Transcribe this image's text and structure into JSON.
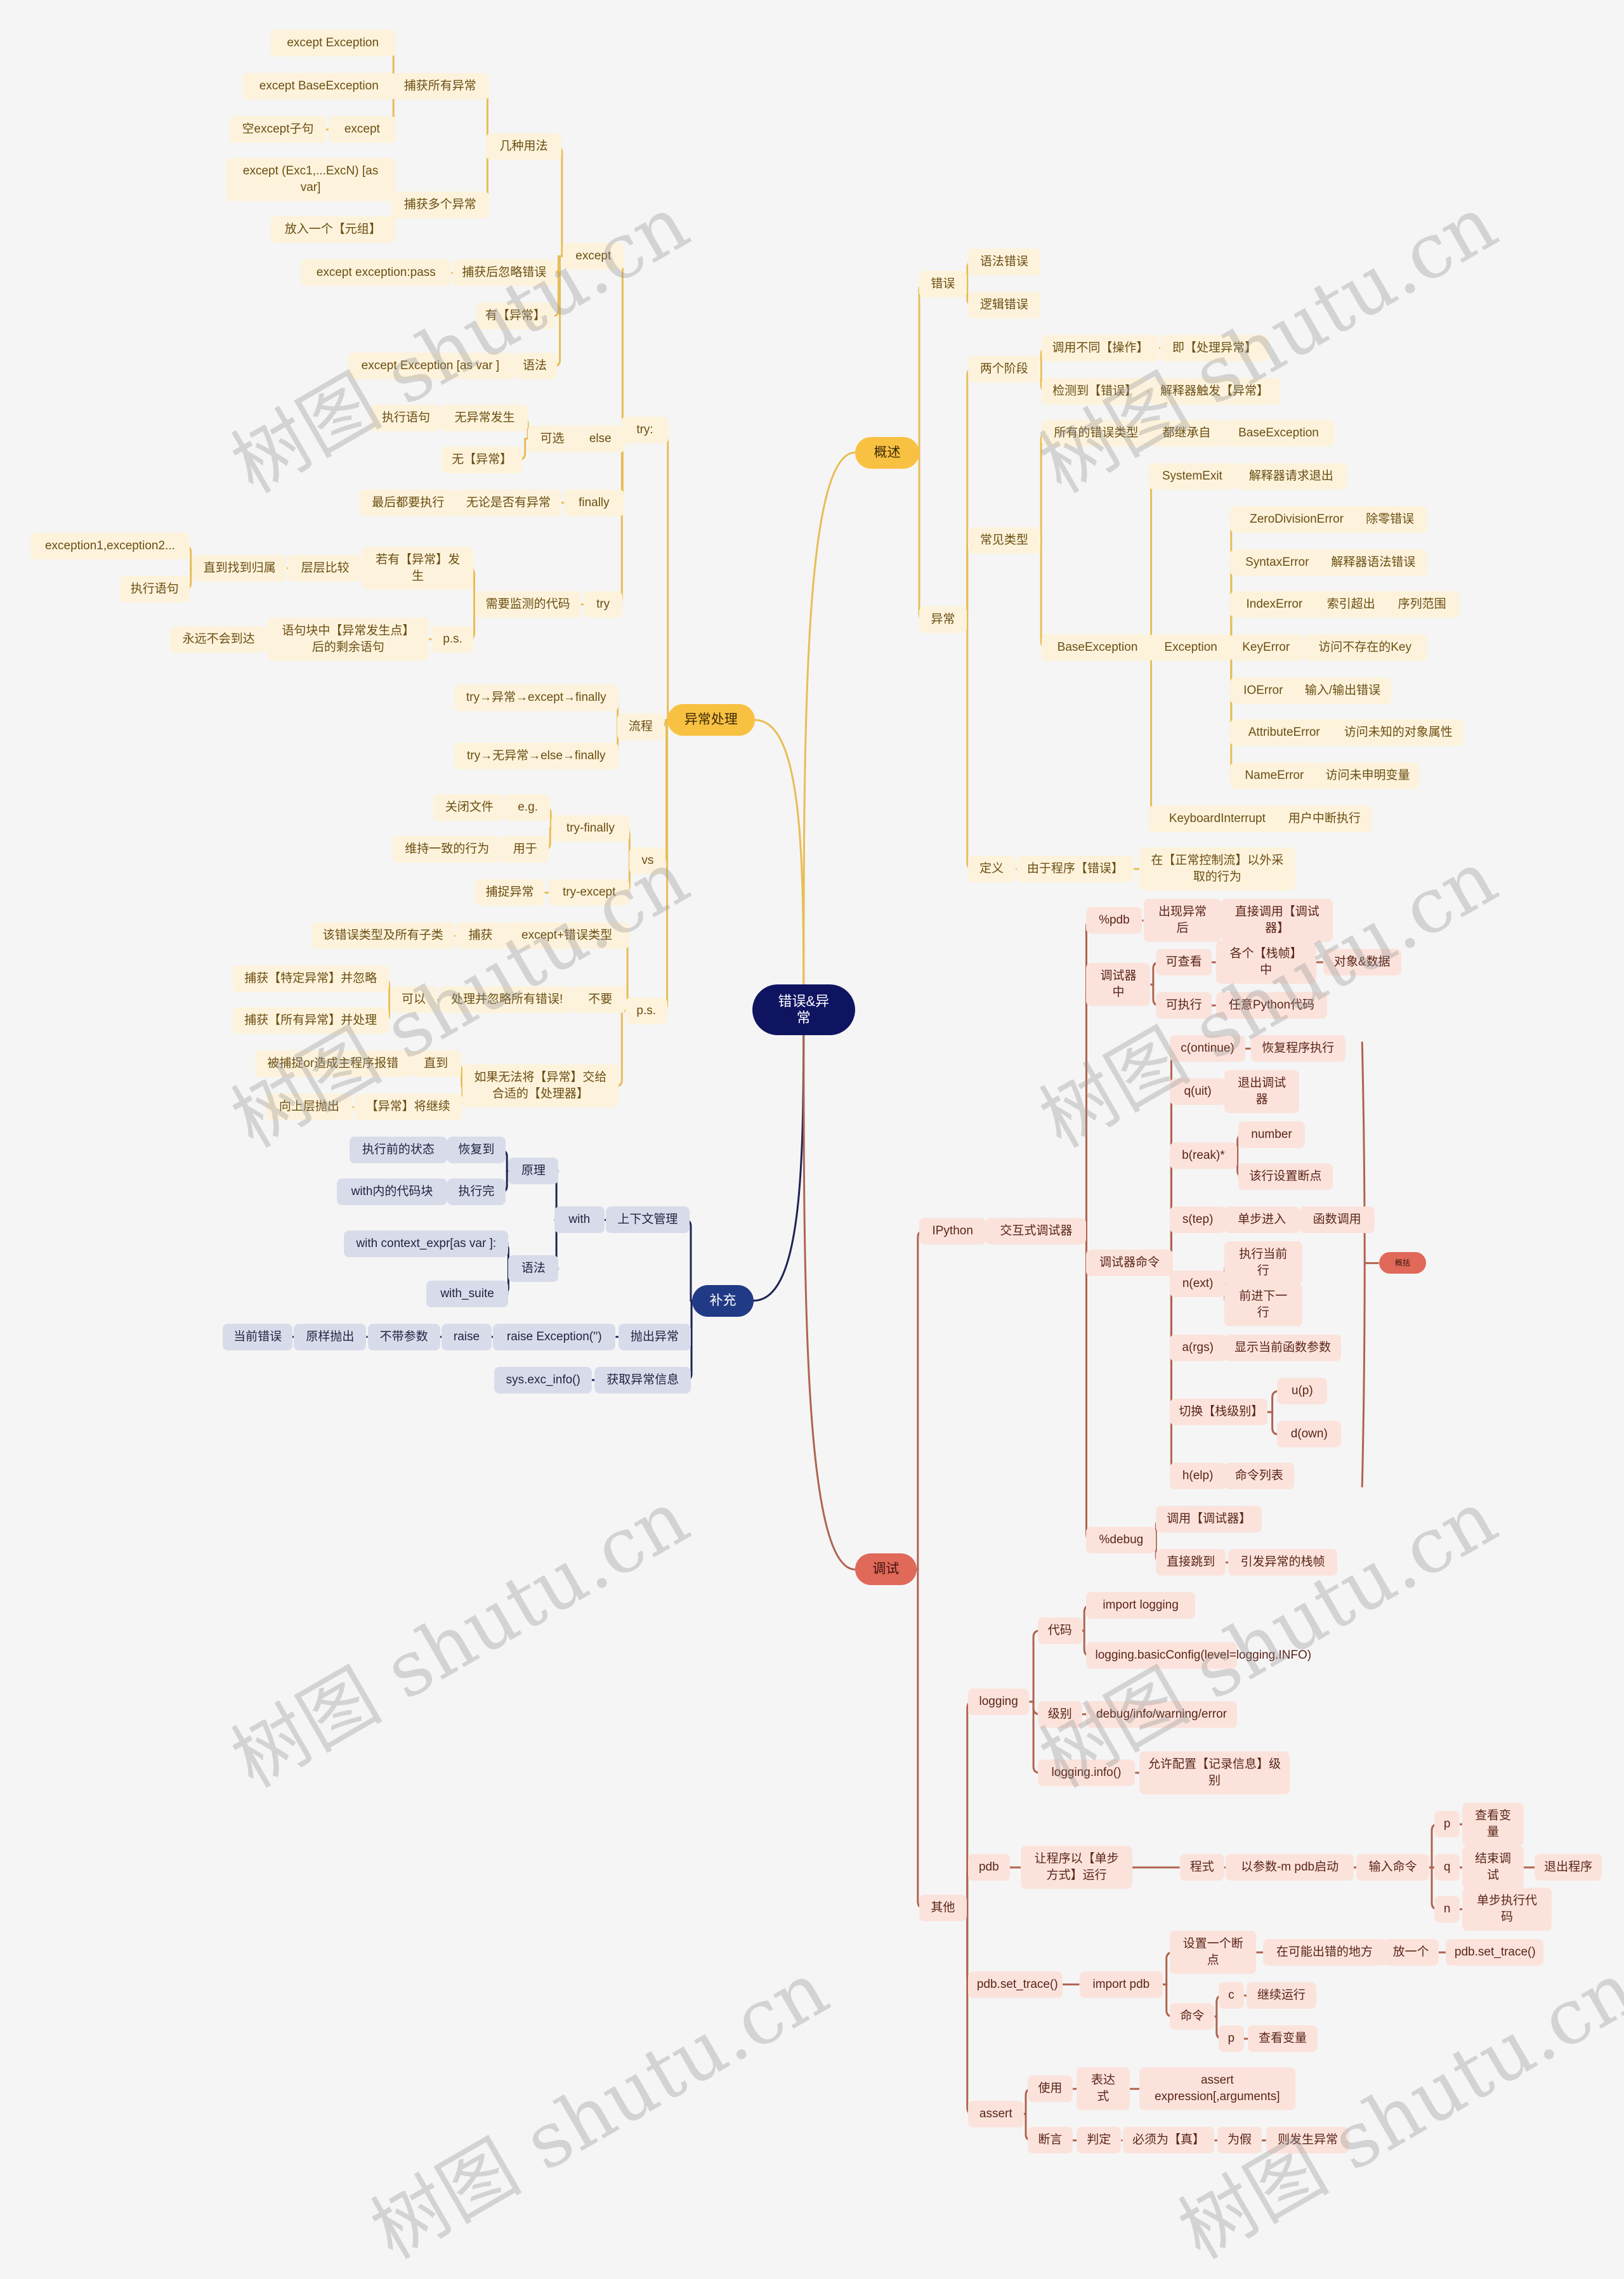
{
  "title": "错误&异常",
  "colors": {
    "yellow": "#f9c142",
    "red": "#e0695a",
    "blue": "#213a85",
    "root": "#0f1461",
    "background": "#f5f5f5"
  },
  "watermark": "树图 shutu.cn",
  "summary_label": "概括",
  "branches": {
    "exception_handling": {
      "label": "异常处理",
      "try": {
        "label": "try:",
        "except": {
          "label": "except",
          "usages": {
            "label": "几种用法",
            "catch_all": {
              "label": "捕获所有异常",
              "items": [
                "except Exception",
                "except BaseException",
                "except"
              ],
              "except_note": "空except子句"
            },
            "catch_multi": {
              "label": "捕获多个异常",
              "items": [
                "except (Exc1,...ExcN) [as var]",
                "放入一个【元组】"
              ]
            }
          },
          "ignore": {
            "label": "捕获后忽略错误",
            "value": "except exception:pass"
          },
          "has": "有【异常】",
          "syntax": {
            "label": "语法",
            "value": "except Exception [as var ]"
          }
        },
        "else": {
          "label": "else",
          "optional": "可选",
          "no_exc": "无异常发生",
          "exec": "执行语句",
          "none": "无【异常】"
        },
        "finally": {
          "label": "finally",
          "regardless": "无论是否有异常",
          "always": "最后都要执行"
        },
        "try_block": {
          "label": "try",
          "monitored": "需要监测的代码",
          "if_exc": "若有【异常】发生",
          "compare": "层层比较",
          "until": "直到找到归属",
          "exc_list": "exception1,exception2...",
          "exec": "执行语句",
          "ps": "p.s.",
          "rest": "语句块中【异常发生点】后的剩余语句",
          "never": "永远不会到达"
        }
      },
      "flow": {
        "label": "流程",
        "items": [
          "try→异常→except→finally",
          "try→无异常→else→finally"
        ]
      },
      "vs": {
        "label": "vs",
        "try_finally": {
          "label": "try-finally",
          "eg": "e.g.",
          "close_file": "关闭文件",
          "used_for": "用于",
          "consistent": "维持一致的行为"
        },
        "try_except": {
          "label": "try-except",
          "catch": "捕捉异常"
        }
      },
      "ps": {
        "label": "p.s.",
        "except_type": {
          "label": "except+错误类型",
          "catch": "捕获",
          "subclasses": "该错误类型及所有子类"
        },
        "dont": {
          "label": "不要",
          "ignore_all": "处理并忽略所有错误!",
          "can": "可以",
          "specific": "捕获【特定异常】并忽略",
          "all": "捕获【所有异常】并处理"
        },
        "propagate": {
          "label": "如果无法将【异常】交给合适的【处理器】",
          "continue": "【异常】将继续",
          "up": "向上层抛出",
          "until": "直到",
          "caught": "被捕捉or造成主程序报错"
        }
      }
    },
    "supplement": {
      "label": "补充",
      "context": {
        "label": "上下文管理",
        "with": "with",
        "principle": {
          "label": "原理",
          "restore": "恢复到",
          "before_state": "执行前的状态",
          "finish": "执行完",
          "with_block": "with内的代码块"
        },
        "syntax": {
          "label": "语法",
          "expr": "with context_expr[as var ]:",
          "suite": "with_suite"
        }
      },
      "raise": {
        "label": "抛出异常",
        "chain": [
          "raise Exception('')",
          "raise",
          "不带参数",
          "原样抛出",
          "当前错误"
        ]
      },
      "exc_info": {
        "label": "获取异常信息",
        "value": "sys.exc_info()"
      }
    },
    "overview": {
      "label": "概述",
      "error": {
        "label": "错误",
        "items": [
          "语法错误",
          "逻辑错误"
        ]
      },
      "exception": {
        "label": "异常",
        "two_stages": {
          "label": "两个阶段",
          "items": [
            [
              "调用不同【操作】",
              "即【处理异常】"
            ],
            [
              "检测到【错误】",
              "解释器触发【异常】"
            ]
          ]
        },
        "common_types": {
          "label": "常见类型",
          "all_types": [
            "所有的错误类型",
            "都继承自",
            "BaseException"
          ],
          "base": {
            "label": "BaseException",
            "system_exit": [
              "SystemExit",
              "解释器请求退出"
            ],
            "exception": {
              "label": "Exception",
              "items": [
                [
                  "ZeroDivisionError",
                  "除零错误"
                ],
                [
                  "SyntaxError",
                  "解释器语法错误"
                ],
                [
                  "IndexError",
                  "索引超出",
                  "序列范围"
                ],
                [
                  "KeyError",
                  "访问不存在的Key"
                ],
                [
                  "IOError",
                  "输入/输出错误"
                ],
                [
                  "AttributeError",
                  "访问未知的对象属性"
                ],
                [
                  "NameError",
                  "访问未申明变量"
                ]
              ]
            },
            "keyboard": [
              "KeyboardInterrupt",
              "用户中断执行"
            ]
          }
        },
        "definition": {
          "label": "定义",
          "chain": [
            "由于程序【错误】",
            "在【正常控制流】以外采取的行为"
          ]
        }
      }
    },
    "debug": {
      "label": "调试",
      "ipython": {
        "label": "IPython",
        "interactive": "交互式调试器",
        "pdb": [
          "%pdb",
          "出现异常后",
          "直接调用【调试器】"
        ],
        "in_debugger": {
          "label": "调试器中",
          "view": [
            "可查看",
            "各个【栈帧】中",
            "对象&数据"
          ],
          "exec": [
            "可执行",
            "任意Python代码"
          ]
        },
        "commands": {
          "label": "调试器命令",
          "items": [
            [
              "c(ontinue)",
              "恢复程序执行"
            ],
            [
              "q(uit)",
              "退出调试器"
            ],
            [
              "b(reak)*",
              "number",
              "该行设置断点"
            ],
            [
              "s(tep)",
              "单步进入",
              "函数调用"
            ],
            [
              "n(ext)",
              "执行当前行",
              "前进下一行"
            ],
            [
              "a(rgs)",
              "显示当前函数参数"
            ],
            [
              "切换【栈级别】",
              "u(p)",
              "d(own)"
            ],
            [
              "h(elp)",
              "命令列表"
            ]
          ]
        },
        "debug_magic": {
          "label": "%debug",
          "call": "调用【调试器】",
          "jump": [
            "直接跳到",
            "引发异常的栈帧"
          ]
        }
      },
      "other": {
        "label": "其他",
        "logging": {
          "label": "logging",
          "code": {
            "label": "代码",
            "items": [
              "import logging",
              "logging.basicConfig(level=logging.INFO)"
            ]
          },
          "level": {
            "label": "级别",
            "value": "debug/info/warning/error"
          },
          "info": {
            "label": "logging.info()",
            "value": "允许配置【记录信息】级别"
          }
        },
        "pdb": {
          "label": "pdb",
          "chain": [
            "让程序以【单步方式】运行",
            "程式",
            "以参数-m pdb启动",
            "输入命令"
          ],
          "cmds": [
            [
              "p",
              "查看变量"
            ],
            [
              "q",
              "结束调试",
              "退出程序"
            ],
            [
              "n",
              "单步执行代码"
            ]
          ]
        },
        "set_trace": {
          "label": "pdb.set_trace()",
          "import": "import pdb",
          "breakpoint": [
            "设置一个断点",
            "在可能出错的地方",
            "放一个",
            "pdb.set_trace()"
          ],
          "cmd": {
            "label": "命令",
            "items": [
              [
                "c",
                "继续运行"
              ],
              [
                "p",
                "查看变量"
              ]
            ]
          }
        },
        "assert": {
          "label": "assert",
          "use": [
            "使用",
            "表达式",
            "assert expression[,arguments]"
          ],
          "assertion": [
            "断言",
            "判定",
            "必须为【真】",
            "为假",
            "则发生异常"
          ]
        }
      }
    }
  }
}
